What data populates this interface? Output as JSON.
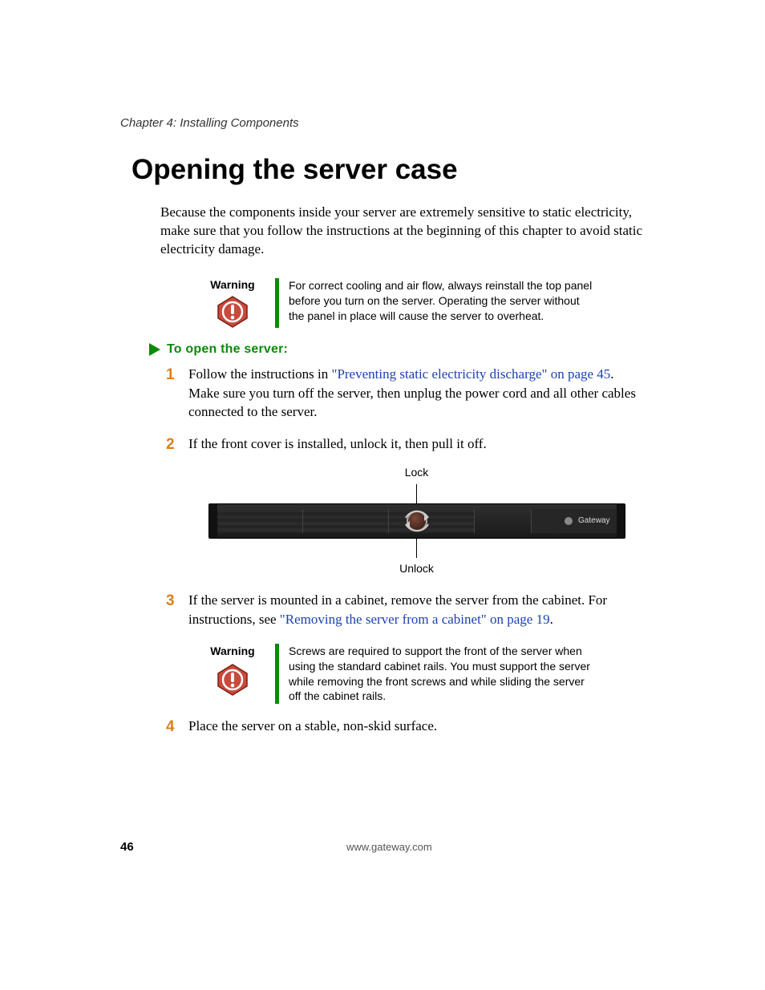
{
  "chapter_caption": "Chapter 4: Installing Components",
  "title": "Opening the server case",
  "intro": "Because the components inside your server are extremely sensitive to static electricity, make sure that you follow the instructions at the beginning of this chapter to avoid static electricity damage.",
  "warning1": {
    "label": "Warning",
    "text": "For correct cooling and air flow, always reinstall the top panel before you turn on the server. Operating the server without the panel in place will cause the server to overheat."
  },
  "section_head": "To open the server:",
  "steps": {
    "s1": {
      "num": "1",
      "pre": "Follow the instructions in ",
      "link": "\"Preventing static electricity discharge\" on page 45",
      "post": ". Make sure you turn off the server, then unplug the power cord and all other cables connected to the server."
    },
    "s2": {
      "num": "2",
      "text": "If the front cover is installed, unlock it, then pull it off."
    },
    "s3": {
      "num": "3",
      "pre": "If the server is mounted in a cabinet, remove the server from the cabinet. For instructions, see ",
      "link": "\"Removing the server from a cabinet\" on page 19",
      "post": "."
    },
    "s4": {
      "num": "4",
      "text": "Place the server on a stable, non-skid surface."
    }
  },
  "figure": {
    "lock_label": "Lock",
    "unlock_label": "Unlock",
    "brand": "Gateway"
  },
  "warning2": {
    "label": "Warning",
    "text": "Screws are required to support the front of the server when using the standard cabinet rails. You must support the server while removing the front screws and while sliding the server off the cabinet rails."
  },
  "footer": {
    "page": "46",
    "url": "www.gateway.com"
  },
  "colors": {
    "accent_green": "#0a8a0a",
    "step_orange": "#d9801c",
    "link_blue": "#1c3fb5",
    "warning_red": "#c94a3b"
  }
}
